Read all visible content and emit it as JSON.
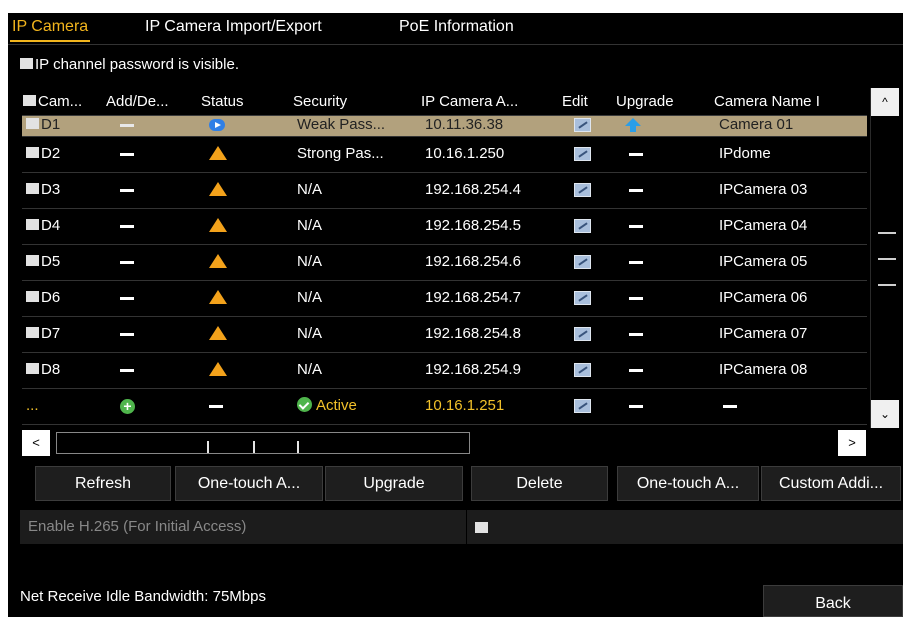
{
  "tabs": [
    {
      "label": "IP Camera",
      "active": true
    },
    {
      "label": "IP Camera Import/Export",
      "active": false
    },
    {
      "label": "PoE Information",
      "active": false
    }
  ],
  "password_visible_label": "IP channel password is visible.",
  "table": {
    "columns": [
      "Cam...",
      "Add/De...",
      "Status",
      "Security",
      "IP Camera A...",
      "Edit",
      "Upgrade",
      "Camera Name I"
    ],
    "rows": [
      {
        "cam": "D1",
        "security": "Weak Pass...",
        "ip": "10.11.36.38",
        "name": "Camera 01",
        "status_icon": "play-icon",
        "upgrade_icon": "upgrade-icon",
        "selected": true
      },
      {
        "cam": "D2",
        "security": "Strong Pas...",
        "ip": "10.16.1.250",
        "name": "IPdome",
        "status_icon": "warning-icon"
      },
      {
        "cam": "D3",
        "security": "N/A",
        "ip": "192.168.254.4",
        "name": "IPCamera 03",
        "status_icon": "warning-icon"
      },
      {
        "cam": "D4",
        "security": "N/A",
        "ip": "192.168.254.5",
        "name": "IPCamera 04",
        "status_icon": "warning-icon"
      },
      {
        "cam": "D5",
        "security": "N/A",
        "ip": "192.168.254.6",
        "name": "IPCamera 05",
        "status_icon": "warning-icon"
      },
      {
        "cam": "D6",
        "security": "N/A",
        "ip": "192.168.254.7",
        "name": "IPCamera 06",
        "status_icon": "warning-icon"
      },
      {
        "cam": "D7",
        "security": "N/A",
        "ip": "192.168.254.8",
        "name": "IPCamera 07",
        "status_icon": "warning-icon"
      },
      {
        "cam": "D8",
        "security": "N/A",
        "ip": "192.168.254.9",
        "name": "IPCamera 08",
        "status_icon": "warning-icon"
      }
    ],
    "add_row": {
      "cam": "...",
      "security": "Active",
      "ip": "10.16.1.251"
    }
  },
  "scroll": {
    "up": "^",
    "down": "⌄",
    "left": "<",
    "right": ">"
  },
  "buttons": [
    "Refresh",
    "One-touch A...",
    "Upgrade",
    "Delete",
    "One-touch A...",
    "Custom Addi..."
  ],
  "h265_label": "Enable H.265 (For Initial Access)",
  "bandwidth_label": "Net Receive Idle Bandwidth: 75Mbps",
  "back_label": "Back",
  "colors": {
    "accent": "#f2b51d",
    "selected_row": "#b2a17d",
    "warning": "#f3a21b",
    "active_green": "#4fb54c",
    "add_row_text": "#f2c12a"
  }
}
